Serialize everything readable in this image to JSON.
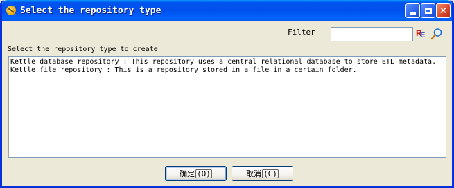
{
  "window": {
    "title": "Select the repository type"
  },
  "filter": {
    "label": "Filter",
    "value": "",
    "placeholder": ""
  },
  "list": {
    "label": "Select the repository type to create",
    "items": [
      "Kettle database repository : This repository uses a central relational database to store ETL metadata.",
      "Kettle file repository : This is a repository stored in a file in a certain folder."
    ]
  },
  "buttons": {
    "ok_label": "确定",
    "ok_mnemonic": "(O)",
    "cancel_label": "取消",
    "cancel_mnemonic": "(C)"
  },
  "icons": {
    "app": "spoon-icon",
    "regex": "regex-icon",
    "search": "search-icon",
    "minimize": "minimize-icon",
    "maximize": "maximize-icon",
    "close": "close-icon"
  },
  "colors": {
    "titlebar": "#0053ee",
    "window_bg": "#ece9d8",
    "close_button": "#d8462a"
  }
}
